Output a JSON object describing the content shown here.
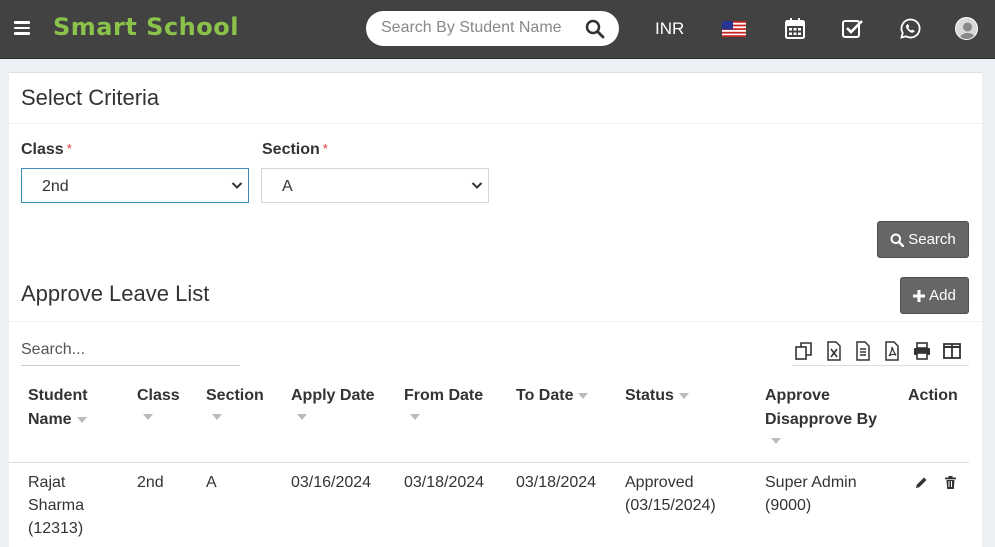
{
  "header": {
    "brand": "Smart School",
    "search_placeholder": "Search By Student Name",
    "currency": "INR",
    "icons": [
      "menu-icon",
      "search-icon",
      "us-flag-icon",
      "calendar-icon",
      "task-check-icon",
      "whatsapp-icon",
      "user-avatar-icon"
    ]
  },
  "criteria": {
    "title": "Select Criteria",
    "class_label": "Class",
    "section_label": "Section",
    "required_mark": "*",
    "class_value": "2nd",
    "section_value": "A",
    "search_button": "Search"
  },
  "list": {
    "title": "Approve Leave List",
    "add_button": "Add",
    "search_placeholder": "Search...",
    "tool_icons": [
      "copy-icon",
      "excel-icon",
      "csv-icon",
      "pdf-icon",
      "print-icon",
      "columns-icon"
    ],
    "columns": [
      {
        "line1": "Student",
        "line2": "Name"
      },
      {
        "line1": "Class",
        "line2": ""
      },
      {
        "line1": "Section",
        "line2": ""
      },
      {
        "line1": "Apply Date",
        "line2": ""
      },
      {
        "line1": "From Date",
        "line2": ""
      },
      {
        "line1": "To Date",
        "line2": ""
      },
      {
        "line1": "Status",
        "line2": ""
      },
      {
        "line1": "Approve",
        "line2": "Disapprove By"
      },
      {
        "line1": "Action",
        "line2": ""
      }
    ],
    "rows": [
      {
        "student_name": "Rajat",
        "student_name2": "Sharma",
        "student_id": "(12313)",
        "class": "2nd",
        "section": "A",
        "apply_date": "03/16/2024",
        "from_date": "03/18/2024",
        "to_date": "03/18/2024",
        "status": "Approved",
        "status_date": "(03/15/2024)",
        "approved_by": "Super Admin",
        "approved_by_id": "(9000)"
      }
    ]
  },
  "colors": {
    "topbar": "#424242",
    "brand": "#8bc34a",
    "button": "#666666",
    "page_bg": "#ecf0f5"
  }
}
